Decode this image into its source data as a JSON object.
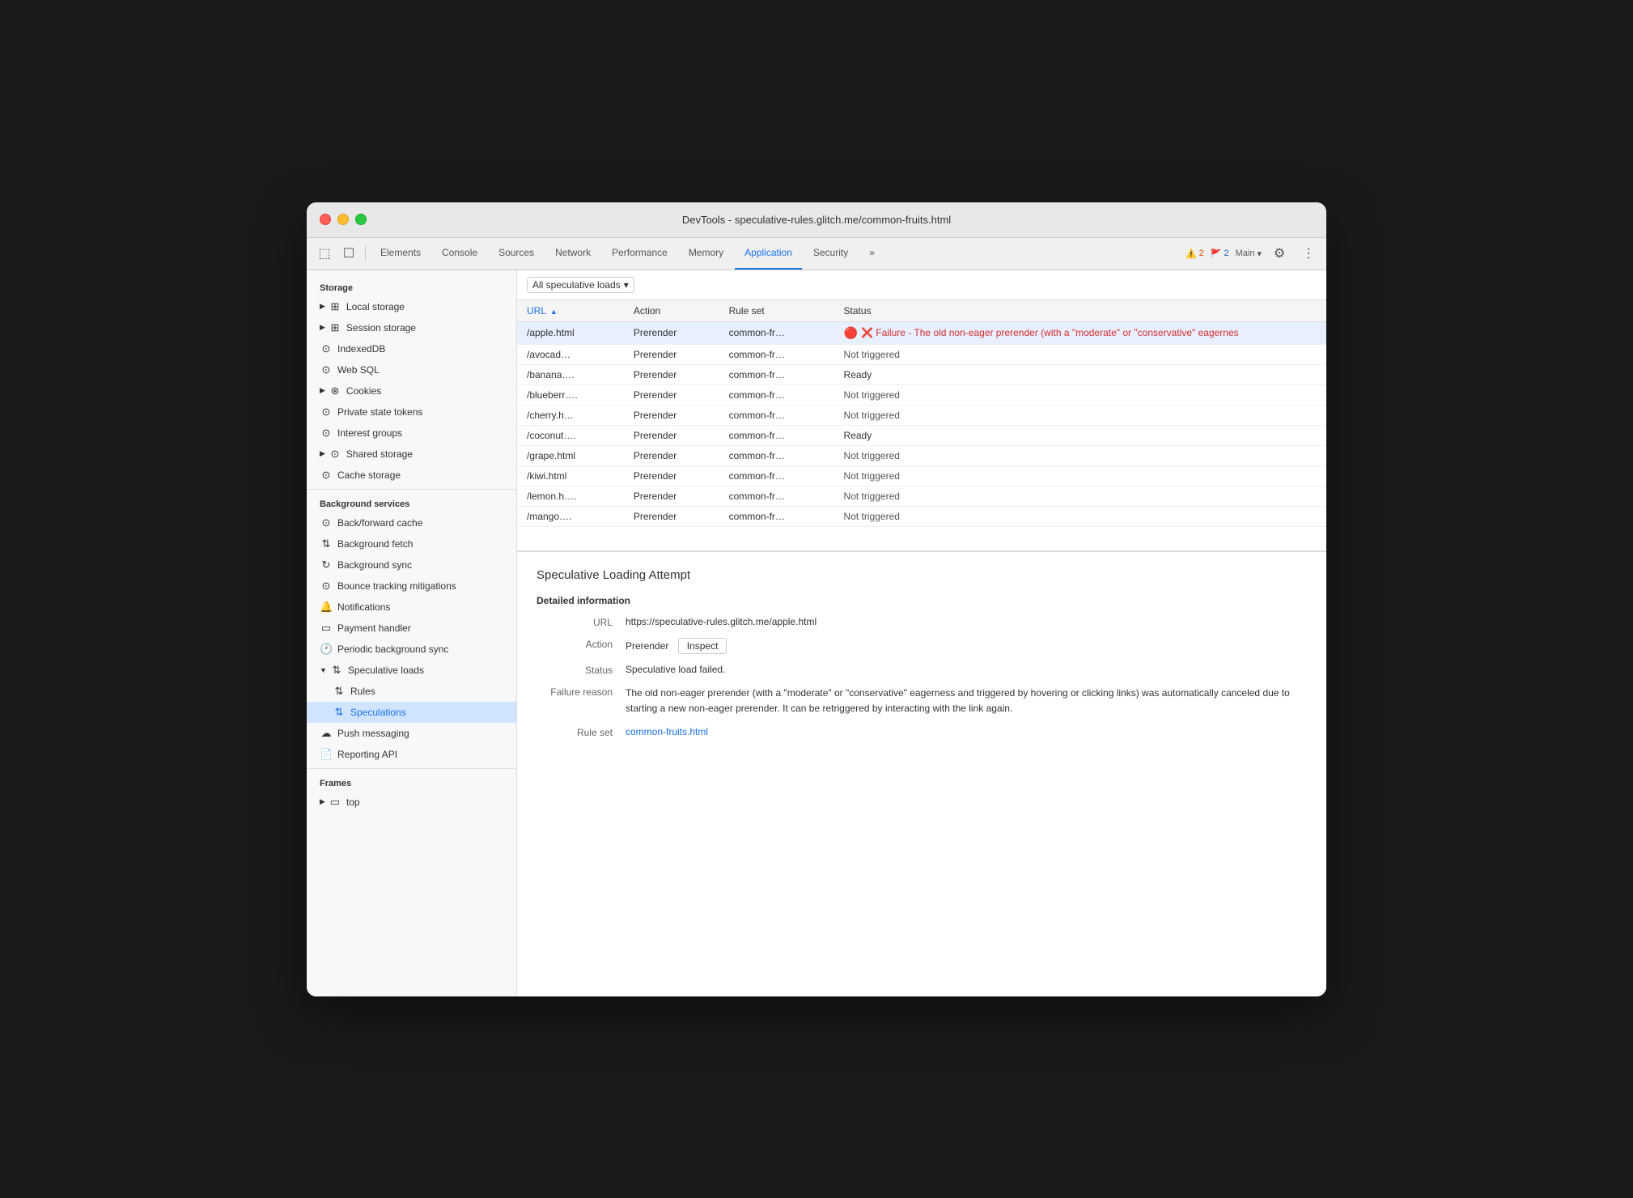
{
  "window": {
    "title": "DevTools - speculative-rules.glitch.me/common-fruits.html"
  },
  "toolbar": {
    "tabs": [
      {
        "id": "elements",
        "label": "Elements",
        "active": false
      },
      {
        "id": "console",
        "label": "Console",
        "active": false
      },
      {
        "id": "sources",
        "label": "Sources",
        "active": false
      },
      {
        "id": "network",
        "label": "Network",
        "active": false
      },
      {
        "id": "performance",
        "label": "Performance",
        "active": false
      },
      {
        "id": "memory",
        "label": "Memory",
        "active": false
      },
      {
        "id": "application",
        "label": "Application",
        "active": true
      },
      {
        "id": "security",
        "label": "Security",
        "active": false
      }
    ],
    "warn_count": "2",
    "info_count": "2",
    "main_label": "Main",
    "more_label": "»"
  },
  "sidebar": {
    "storage_label": "Storage",
    "items_storage": [
      {
        "id": "local-storage",
        "label": "Local storage",
        "icon": "⊞",
        "has_arrow": true,
        "indented": false
      },
      {
        "id": "session-storage",
        "label": "Session storage",
        "icon": "⊞",
        "has_arrow": true,
        "indented": false
      },
      {
        "id": "indexeddb",
        "label": "IndexedDB",
        "icon": "⊙",
        "has_arrow": false,
        "indented": false
      },
      {
        "id": "web-sql",
        "label": "Web SQL",
        "icon": "⊙",
        "has_arrow": false,
        "indented": false
      },
      {
        "id": "cookies",
        "label": "Cookies",
        "icon": "🍪",
        "has_arrow": true,
        "indented": false
      },
      {
        "id": "private-state-tokens",
        "label": "Private state tokens",
        "icon": "⊙",
        "has_arrow": false,
        "indented": false
      },
      {
        "id": "interest-groups",
        "label": "Interest groups",
        "icon": "⊙",
        "has_arrow": false,
        "indented": false
      },
      {
        "id": "shared-storage",
        "label": "Shared storage",
        "icon": "⊙",
        "has_arrow": true,
        "indented": false
      },
      {
        "id": "cache-storage",
        "label": "Cache storage",
        "icon": "⊙",
        "has_arrow": false,
        "indented": false
      }
    ],
    "background_label": "Background services",
    "items_background": [
      {
        "id": "back-forward-cache",
        "label": "Back/forward cache",
        "icon": "⊙",
        "indented": false
      },
      {
        "id": "background-fetch",
        "label": "Background fetch",
        "icon": "↑↓",
        "indented": false
      },
      {
        "id": "background-sync",
        "label": "Background sync",
        "icon": "↻",
        "indented": false
      },
      {
        "id": "bounce-tracking",
        "label": "Bounce tracking mitigations",
        "icon": "⊙",
        "indented": false
      },
      {
        "id": "notifications",
        "label": "Notifications",
        "icon": "🔔",
        "indented": false
      },
      {
        "id": "payment-handler",
        "label": "Payment handler",
        "icon": "▭",
        "indented": false
      },
      {
        "id": "periodic-background-sync",
        "label": "Periodic background sync",
        "icon": "🕐",
        "indented": false
      },
      {
        "id": "speculative-loads",
        "label": "Speculative loads",
        "icon": "↑↓",
        "has_arrow": true,
        "expanded": true,
        "indented": false
      },
      {
        "id": "rules",
        "label": "Rules",
        "icon": "↑↓",
        "indented": true
      },
      {
        "id": "speculations",
        "label": "Speculations",
        "icon": "↑↓",
        "indented": true,
        "active": true
      },
      {
        "id": "push-messaging",
        "label": "Push messaging",
        "icon": "☁",
        "indented": false
      },
      {
        "id": "reporting-api",
        "label": "Reporting API",
        "icon": "📄",
        "indented": false
      }
    ],
    "frames_label": "Frames",
    "items_frames": [
      {
        "id": "top",
        "label": "top",
        "icon": "▭",
        "has_arrow": true,
        "indented": false
      }
    ]
  },
  "content": {
    "filter": {
      "label": "All speculative loads",
      "icon": "▾"
    },
    "table": {
      "columns": [
        "URL",
        "Action",
        "Rule set",
        "Status"
      ],
      "rows": [
        {
          "url": "/apple.html",
          "action": "Prerender",
          "ruleset": "common-fr…",
          "status": "failure",
          "status_text": "❌ Failure - The old non-eager prerender (with a \"moderate\" or \"conservative\" eagernes"
        },
        {
          "url": "/avocad…",
          "action": "Prerender",
          "ruleset": "common-fr…",
          "status": "not-triggered",
          "status_text": "Not triggered"
        },
        {
          "url": "/banana….",
          "action": "Prerender",
          "ruleset": "common-fr…",
          "status": "ready",
          "status_text": "Ready"
        },
        {
          "url": "/blueberr….",
          "action": "Prerender",
          "ruleset": "common-fr…",
          "status": "not-triggered",
          "status_text": "Not triggered"
        },
        {
          "url": "/cherry.h…",
          "action": "Prerender",
          "ruleset": "common-fr…",
          "status": "not-triggered",
          "status_text": "Not triggered"
        },
        {
          "url": "/coconut….",
          "action": "Prerender",
          "ruleset": "common-fr…",
          "status": "ready",
          "status_text": "Ready"
        },
        {
          "url": "/grape.html",
          "action": "Prerender",
          "ruleset": "common-fr…",
          "status": "not-triggered",
          "status_text": "Not triggered"
        },
        {
          "url": "/kiwi.html",
          "action": "Prerender",
          "ruleset": "common-fr…",
          "status": "not-triggered",
          "status_text": "Not triggered"
        },
        {
          "url": "/lemon.h….",
          "action": "Prerender",
          "ruleset": "common-fr…",
          "status": "not-triggered",
          "status_text": "Not triggered"
        },
        {
          "url": "/mango….",
          "action": "Prerender",
          "ruleset": "common-fr…",
          "status": "not-triggered",
          "status_text": "Not triggered"
        }
      ]
    },
    "detail": {
      "title": "Speculative Loading Attempt",
      "section_label": "Detailed information",
      "url_label": "URL",
      "url_value": "https://speculative-rules.glitch.me/apple.html",
      "action_label": "Action",
      "action_value": "Prerender",
      "inspect_label": "Inspect",
      "status_label": "Status",
      "status_value": "Speculative load failed.",
      "failure_label": "Failure reason",
      "failure_value": "The old non-eager prerender (with a \"moderate\" or \"conservative\" eagerness and triggered by hovering or clicking links) was automatically canceled due to starting a new non-eager prerender. It can be retriggered by interacting with the link again.",
      "ruleset_label": "Rule set",
      "ruleset_link": "common-fruits.html"
    }
  }
}
